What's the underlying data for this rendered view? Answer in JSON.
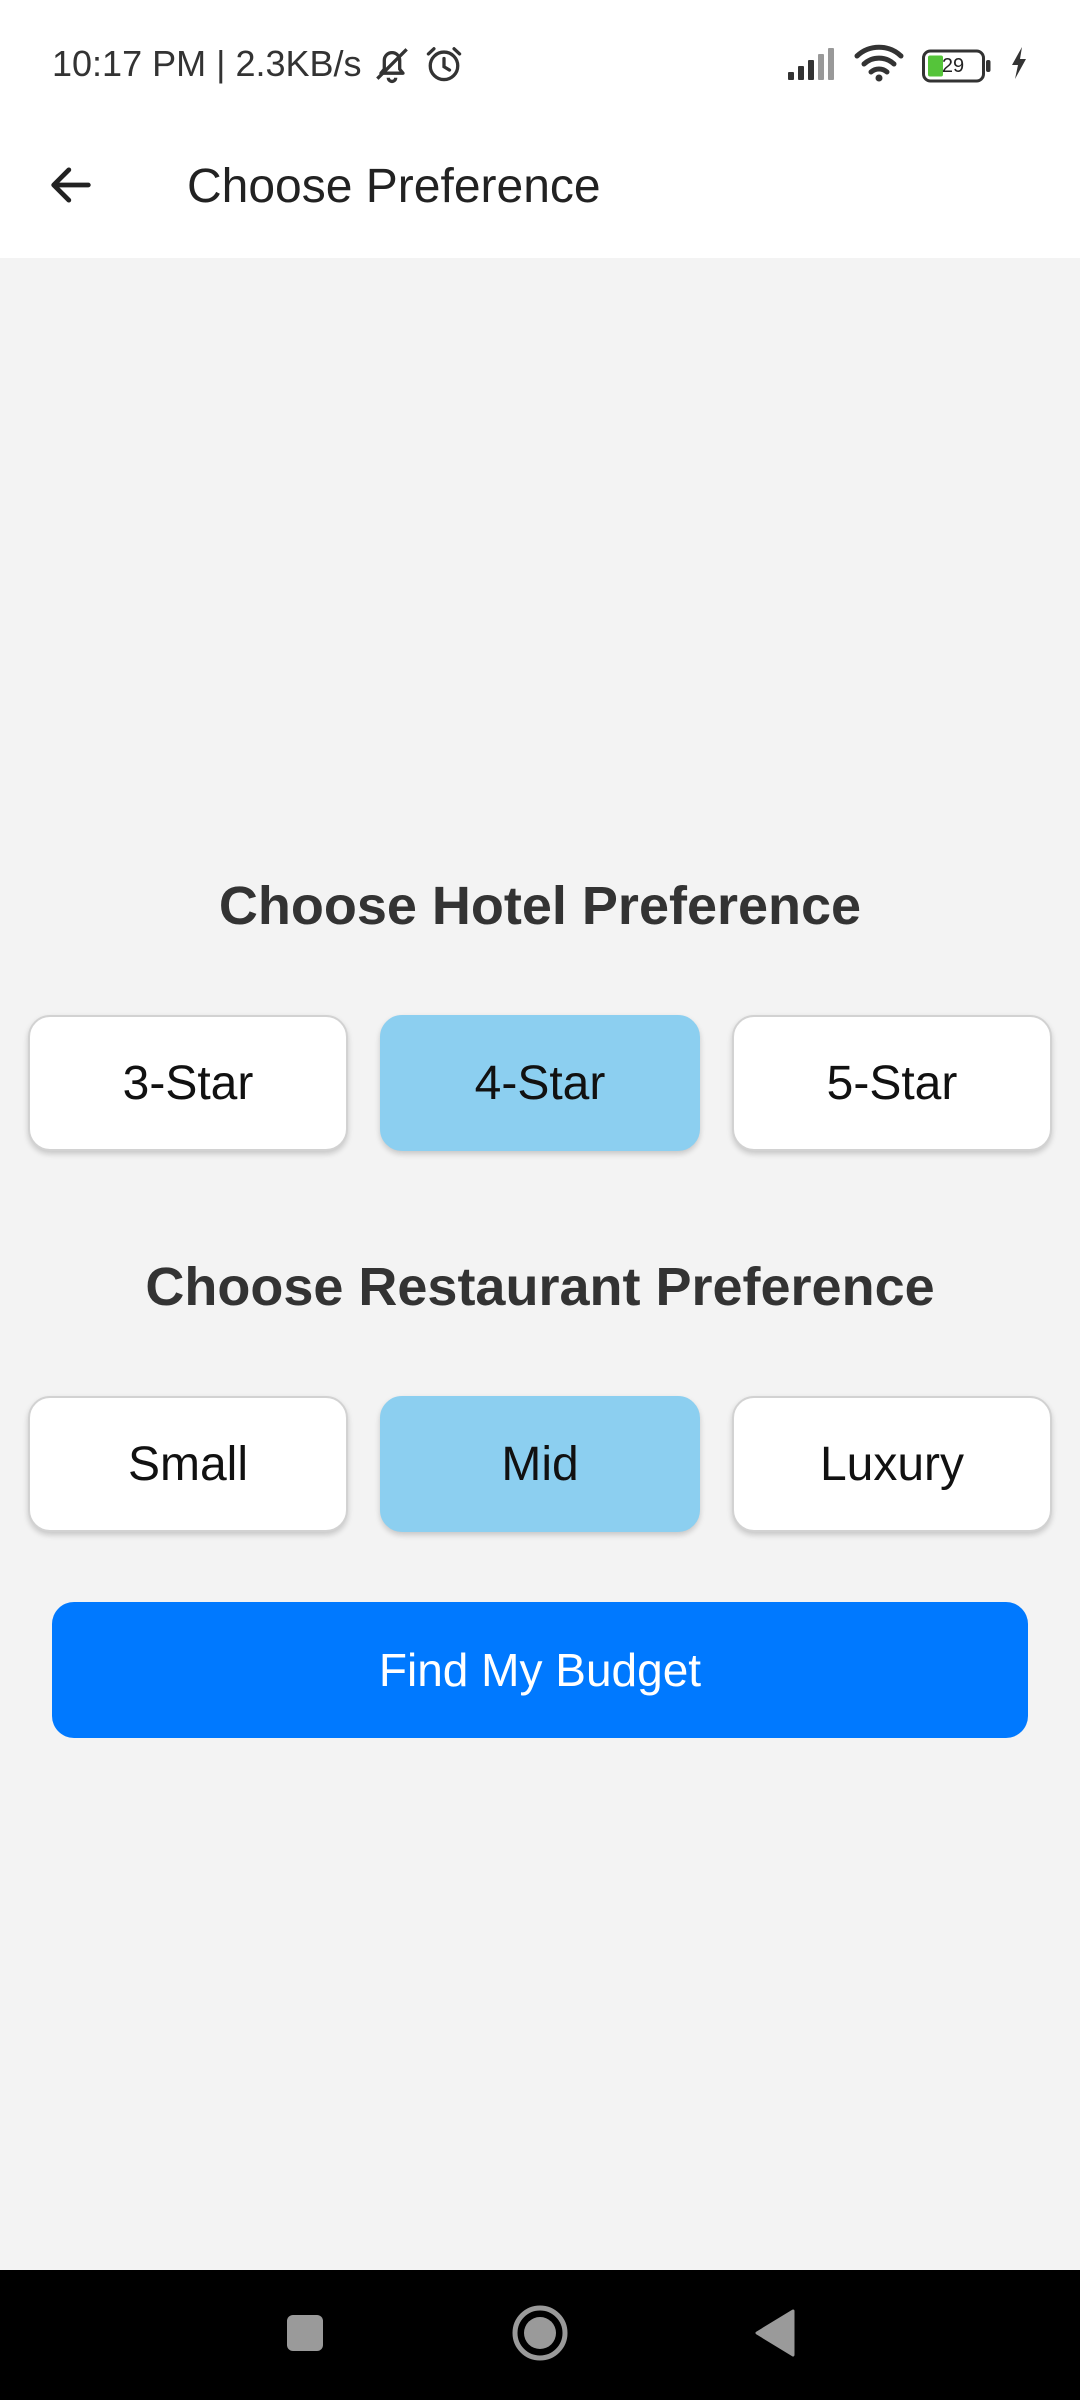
{
  "status_bar": {
    "time_speed": "10:17 PM | 2.3KB/s",
    "battery_level": "29",
    "icons": [
      "mute-bell-icon",
      "alarm-icon",
      "signal-icon",
      "wifi-icon",
      "battery-icon",
      "charging-icon"
    ]
  },
  "app_bar": {
    "title": "Choose Preference",
    "back_icon": "arrow-left-icon"
  },
  "hotel": {
    "heading": "Choose Hotel Preference",
    "options": [
      "3-Star",
      "4-Star",
      "5-Star"
    ],
    "selected": "4-Star"
  },
  "restaurant": {
    "heading": "Choose Restaurant Preference",
    "options": [
      "Small",
      "Mid",
      "Luxury"
    ],
    "selected": "Mid"
  },
  "action": {
    "label": "Find My Budget"
  },
  "nav_bar": {
    "icons": [
      "recents-square-icon",
      "home-circle-icon",
      "back-triangle-icon"
    ]
  },
  "colors": {
    "background": "#f3f3f3",
    "selected_option": "#8ccff0",
    "primary_button": "#0079ff",
    "nav_bar": "#000000"
  }
}
